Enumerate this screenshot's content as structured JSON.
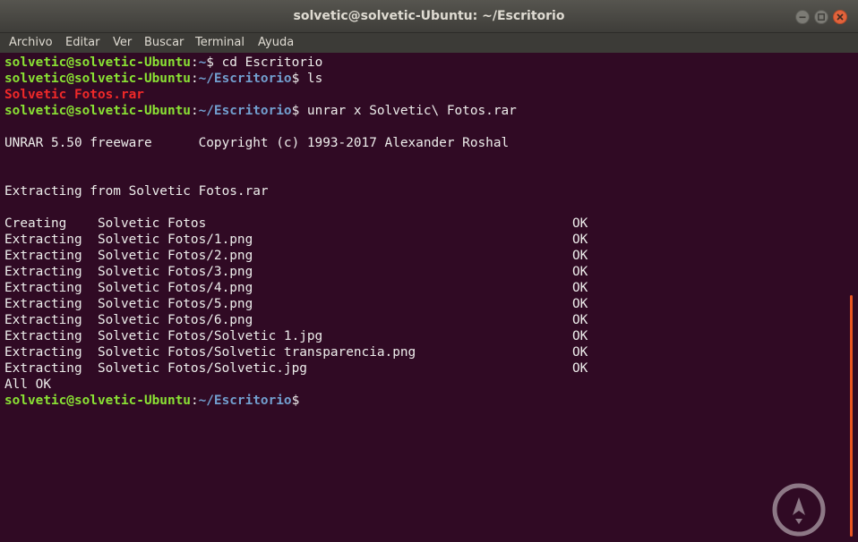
{
  "window": {
    "title": "solvetic@solvetic-Ubuntu: ~/Escritorio"
  },
  "menu": {
    "items": [
      "Archivo",
      "Editar",
      "Ver",
      "Buscar",
      "Terminal",
      "Ayuda"
    ]
  },
  "terminal": {
    "prompt_user_host": "solvetic@solvetic-Ubuntu",
    "prompt_sep": ":",
    "lines": {
      "l0_path": "~",
      "l0_cmd": "$ cd Escritorio",
      "l1_path": "~/Escritorio",
      "l1_cmd": "$ ls",
      "l2": "Solvetic Fotos.rar",
      "l3_path": "~/Escritorio",
      "l3_cmd": "$ unrar x Solvetic\\ Fotos.rar",
      "l5": "UNRAR 5.50 freeware      Copyright (c) 1993-2017 Alexander Roshal",
      "l8": "Extracting from Solvetic Fotos.rar",
      "l10": "Creating    Solvetic Fotos",
      "l11": "Extracting  Solvetic Fotos/1.png",
      "l12": "Extracting  Solvetic Fotos/2.png",
      "l13": "Extracting  Solvetic Fotos/3.png",
      "l14": "Extracting  Solvetic Fotos/4.png",
      "l15": "Extracting  Solvetic Fotos/5.png",
      "l16": "Extracting  Solvetic Fotos/6.png",
      "l17": "Extracting  Solvetic Fotos/Solvetic 1.jpg",
      "l18": "Extracting  Solvetic Fotos/Solvetic transparencia.png",
      "l19": "Extracting  Solvetic Fotos/Solvetic.jpg",
      "ok": "OK",
      "l20": "All OK",
      "l21_path": "~/Escritorio",
      "l21_cmd": "$"
    }
  },
  "colors": {
    "terminal_bg": "#300a24",
    "prompt_user": "#8ae234",
    "prompt_path": "#729fcf",
    "archive_file": "#ef2929",
    "scroll_thumb": "#e95420"
  },
  "icons": {
    "minimize": "minimize-icon",
    "maximize": "maximize-icon",
    "close": "close-icon",
    "watermark": "solvetic-logo"
  }
}
